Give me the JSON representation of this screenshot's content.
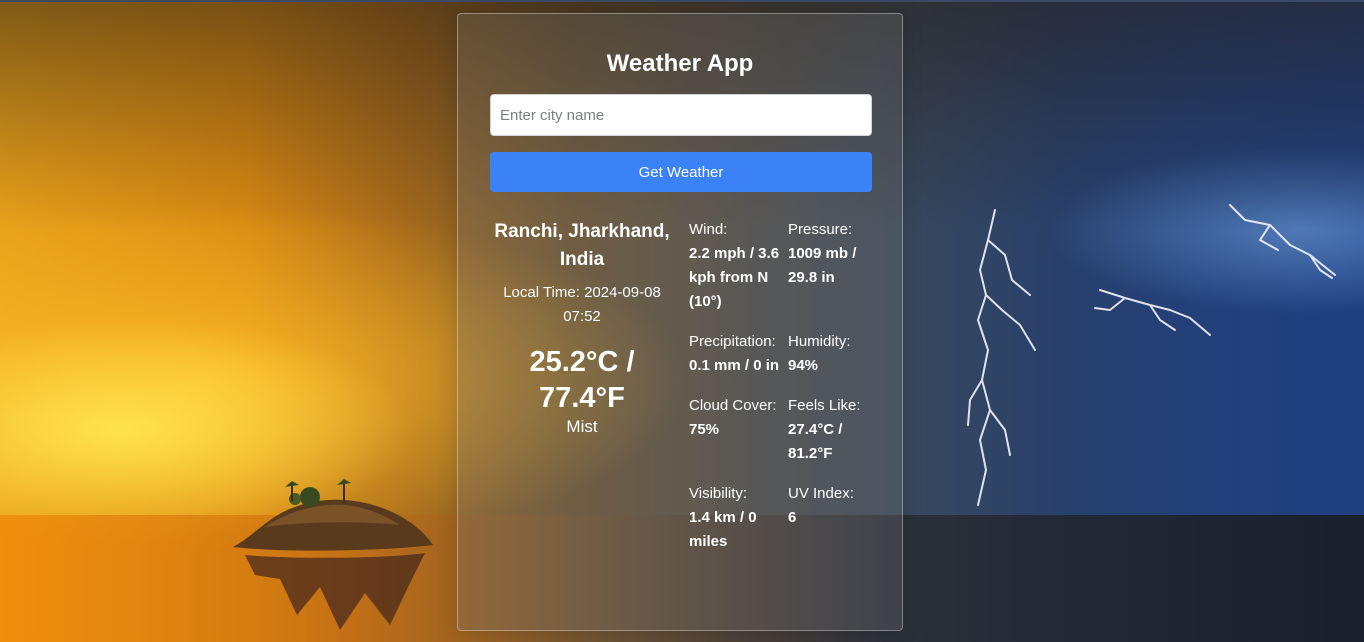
{
  "app": {
    "title": "Weather App"
  },
  "search": {
    "placeholder": "Enter city name",
    "value": "",
    "button_label": "Get Weather"
  },
  "weather": {
    "location": "Ranchi, Jharkhand, India",
    "local_time_label": "Local Time:",
    "local_time": "2024-09-08 07:52",
    "temperature": "25.2°C / 77.4°F",
    "condition": "Mist",
    "stats": [
      {
        "label": "Wind:",
        "value": "2.2 mph / 3.6 kph from N (10°)"
      },
      {
        "label": "Pressure:",
        "value": "1009 mb / 29.8 in"
      },
      {
        "label": "Precipitation:",
        "value": "0.1 mm / 0 in"
      },
      {
        "label": "Humidity:",
        "value": "94%"
      },
      {
        "label": "Cloud Cover:",
        "value": "75%"
      },
      {
        "label": "Feels Like:",
        "value": "27.4°C / 81.2°F"
      },
      {
        "label": "Visibility:",
        "value": "1.4 km / 0 miles"
      },
      {
        "label": "UV Index:",
        "value": "6"
      }
    ]
  },
  "colors": {
    "button": "#3b82f6",
    "text": "#ffffff"
  }
}
